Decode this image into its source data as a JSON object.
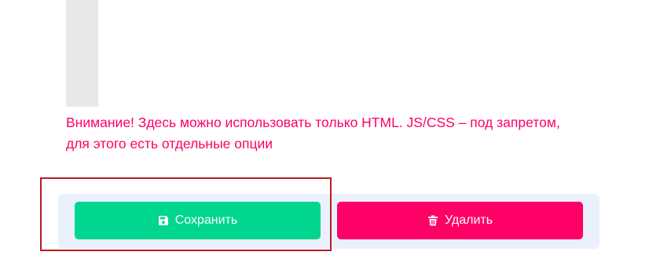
{
  "warning": {
    "text": "Внимание! Здесь можно использовать только HTML. JS/CSS – под запретом, для этого есть отдельные опции",
    "color": "#ff0066"
  },
  "actions": {
    "save_label": "Сохранить",
    "save_icon": "floppy-disk-icon",
    "save_color": "#00d68f",
    "delete_label": "Удалить",
    "delete_icon": "trash-icon",
    "delete_color": "#ff0066"
  }
}
